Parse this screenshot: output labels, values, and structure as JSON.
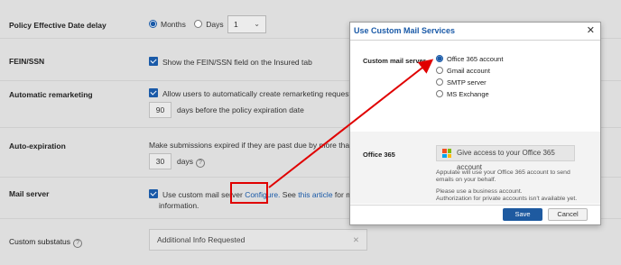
{
  "settings": {
    "policy_delay": {
      "label": "Policy Effective Date delay",
      "option_months": "Months",
      "option_days": "Days",
      "selected_value": "1"
    },
    "fein": {
      "label": "FEIN/SSN",
      "checkbox_text": "Show the FEIN/SSN field on the Insured tab"
    },
    "remarketing": {
      "label": "Automatic remarketing",
      "checkbox_text": "Allow users to automatically create remarketing requests",
      "days_value": "90",
      "days_text": "days before the policy expiration date"
    },
    "expiration": {
      "label": "Auto-expiration",
      "text": "Make submissions expired if they are past due by more than",
      "days_value": "30",
      "days_label": "days"
    },
    "mail": {
      "label": "Mail server",
      "checkbox_text": "Use custom mail server",
      "configure_link": "Configure.",
      "see_text": "See",
      "article_link": "this article",
      "tail_text": "for more",
      "tail_text2": "information."
    },
    "substatus": {
      "label": "Custom substatus",
      "value": "Additional Info Requested"
    }
  },
  "modal": {
    "title": "Use Custom Mail Services",
    "server_label": "Custom mail server",
    "options": [
      "Office 365 account",
      "Gmail account",
      "SMTP server",
      "MS Exchange"
    ],
    "selected_index": 0,
    "office_label": "Office 365",
    "o365_button": "Give access to your Office 365 account",
    "note1_line1": "Appulate will use your Office 365 account to send",
    "note1_line2": "emails on your behalf.",
    "note2_line1": "Please use a business account.",
    "note2_line2": "Authorization for private accounts isn't available yet.",
    "save_label": "Save",
    "cancel_label": "Cancel"
  },
  "colors": {
    "accent": "#1a5aa8",
    "annotation": "#e00000"
  }
}
